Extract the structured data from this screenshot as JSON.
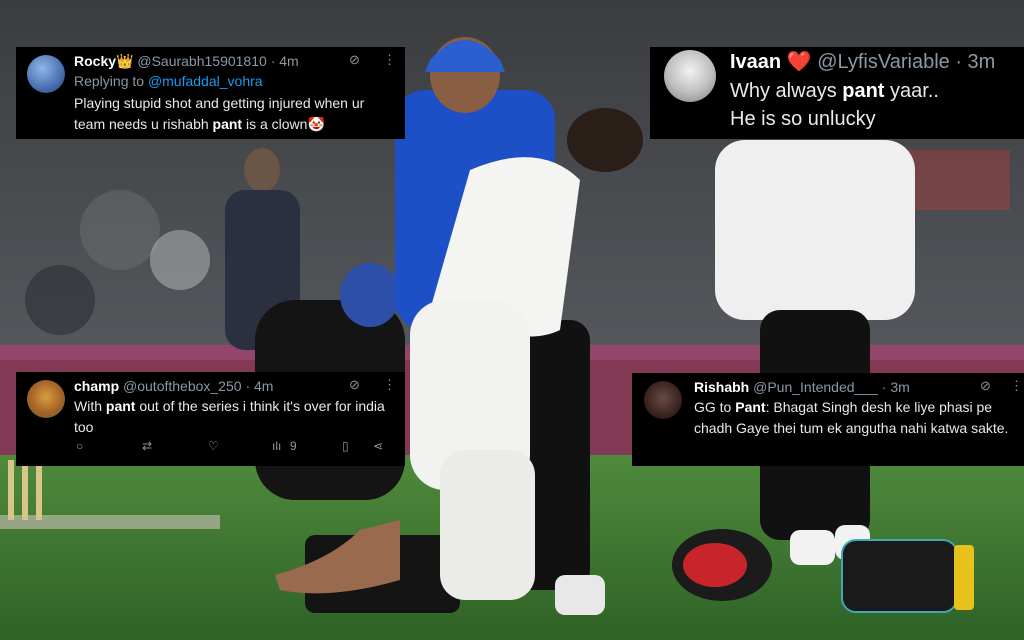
{
  "tweets": {
    "rocky": {
      "name": "Rocky",
      "badge": "👑",
      "handle": "@Saurabh15901810",
      "time": "· 4m",
      "replying_prefix": "Replying to ",
      "replying_to": "@mufaddal_vohra",
      "text_before": "Playing stupid shot and getting injured when ur team needs u rishabh ",
      "keyword": "pant",
      "text_after": " is a clown",
      "emoji": "🤡"
    },
    "ivaan": {
      "name": "Ivaan",
      "heart": "❤️",
      "handle": "@LyfisVariable",
      "time": "· 3m",
      "line1_before": "Why always ",
      "keyword": "pant",
      "line1_after": " yaar..",
      "line2": "He is so unlucky"
    },
    "champ": {
      "name": "champ",
      "handle": "@outofthebox_250",
      "time": "· 4m",
      "text_before": "With ",
      "keyword": "pant",
      "text_after": " out of the series i think it's over for india too",
      "views": "9"
    },
    "rishabh": {
      "name": "Rishabh",
      "handle": "@Pun_Intended___",
      "time": "· 3m",
      "text_before": "GG to ",
      "keyword": "Pant",
      "text_after": ": Bhagat Singh desh ke liye phasi pe chadh Gaye thei tum ek angutha nahi katwa sakte."
    }
  },
  "icons": {
    "grok": "⊘",
    "more": "⋮",
    "reply": "○",
    "retweet": "⇄",
    "like": "♡",
    "views": "ılı",
    "bookmark": "▯",
    "share": "⋖"
  },
  "colors": {
    "pitch_green": "#3f7a33",
    "jersey_blue": "#1d4fc7",
    "link_blue": "#1d9bf0",
    "billboard_pink": "#d63b7c"
  }
}
